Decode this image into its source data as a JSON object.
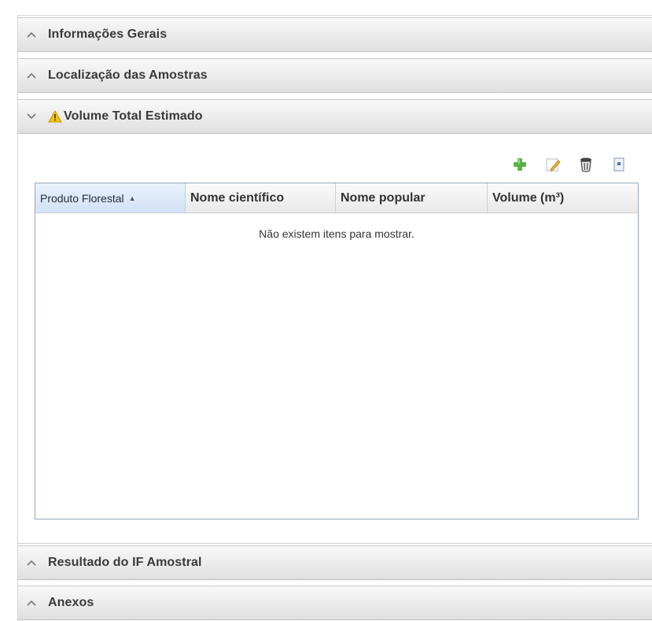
{
  "sections": [
    {
      "title": "Informações Gerais",
      "state": "collapsed"
    },
    {
      "title": "Localização das Amostras",
      "state": "collapsed"
    },
    {
      "title": "Volume Total Estimado",
      "state": "expanded",
      "warning": true
    },
    {
      "title": "Resultado do IF Amostral",
      "state": "collapsed"
    },
    {
      "title": "Anexos",
      "state": "collapsed"
    }
  ],
  "toolbar": {
    "icons": [
      "add-icon",
      "edit-icon",
      "delete-icon",
      "export-icon"
    ]
  },
  "grid": {
    "columns": [
      "Produto Florestal",
      "Nome científico",
      "Nome popular",
      "Volume (m³)"
    ],
    "sorted_column": "Produto Florestal",
    "sort_direction": "ascending",
    "empty_message": "Não existem itens para mostrar."
  },
  "colors": {
    "header_gradient_top": "#f9f9f9",
    "header_gradient_bottom": "#e0e0e0",
    "sorted_column_bg": "#d2e2f6",
    "grid_border": "#9aa6b6",
    "add_icon": "#5bb345",
    "warning_icon": "#f5c400"
  }
}
